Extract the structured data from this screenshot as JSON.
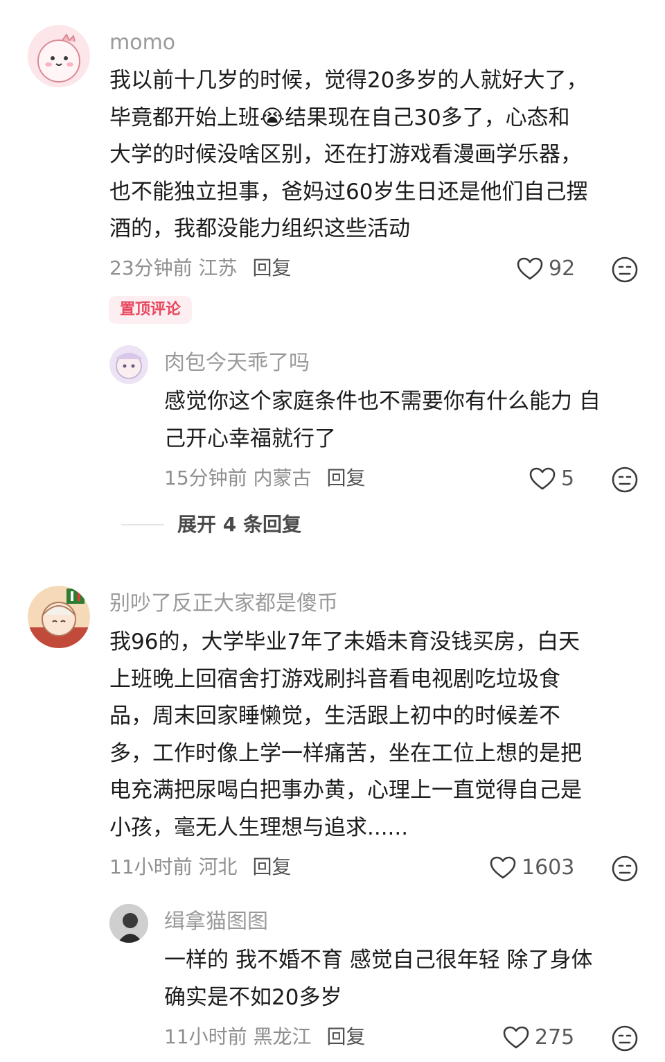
{
  "comments": [
    {
      "username": "momo",
      "lines": [
        "我以前十几岁的时候，觉得20多岁的人就好大了，",
        "毕竟都开始上班😭结果现在自己30多了，心态和",
        "大学的时候没啥区别，还在打游戏看漫画学乐器，",
        "也不能独立担事，爸妈过60岁生日还是他们自己摆",
        "酒的，我都没能力组织这些活动"
      ],
      "meta": "23分钟前 江苏",
      "reply_label": "回复",
      "likes": "92",
      "badge": "置顶评论",
      "replies": [
        {
          "username": "肉包今天乖了吗",
          "lines": [
            "感觉你这个家庭条件也不需要你有什么能力 自",
            "己开心幸福就行了"
          ],
          "meta": "15分钟前 内蒙古",
          "reply_label": "回复",
          "likes": "5"
        }
      ],
      "expand_label": "展开 4 条回复"
    },
    {
      "username": "别吵了反正大家都是傻币",
      "lines": [
        "我96的，大学毕业7年了未婚未育没钱买房，白天",
        "上班晚上回宿舍打游戏刷抖音看电视剧吃垃圾食",
        "品，周末回家睡懒觉，生活跟上初中的时候差不",
        "多，工作时像上学一样痛苦，坐在工位上想的是把",
        "电充满把尿喝白把事办黄，心理上一直觉得自己是",
        "小孩，毫无人生理想与追求......"
      ],
      "meta": "11小时前 河北",
      "reply_label": "回复",
      "likes": "1603",
      "replies": [
        {
          "username": "缉拿猫图图",
          "lines": [
            "一样的 我不婚不育 感觉自己很年轻 除了身体",
            "确实是不如20多岁"
          ],
          "meta": "11小时前 黑龙江",
          "reply_label": "回复",
          "likes": "275"
        }
      ]
    }
  ],
  "icons": {
    "like": "heart-outline-icon",
    "dislike": "meh-face-icon"
  },
  "colors": {
    "pin_bg": "#fdeff1",
    "pin_text": "#e8485f",
    "name": "#9a9a9a",
    "meta": "#8f8f8f"
  }
}
